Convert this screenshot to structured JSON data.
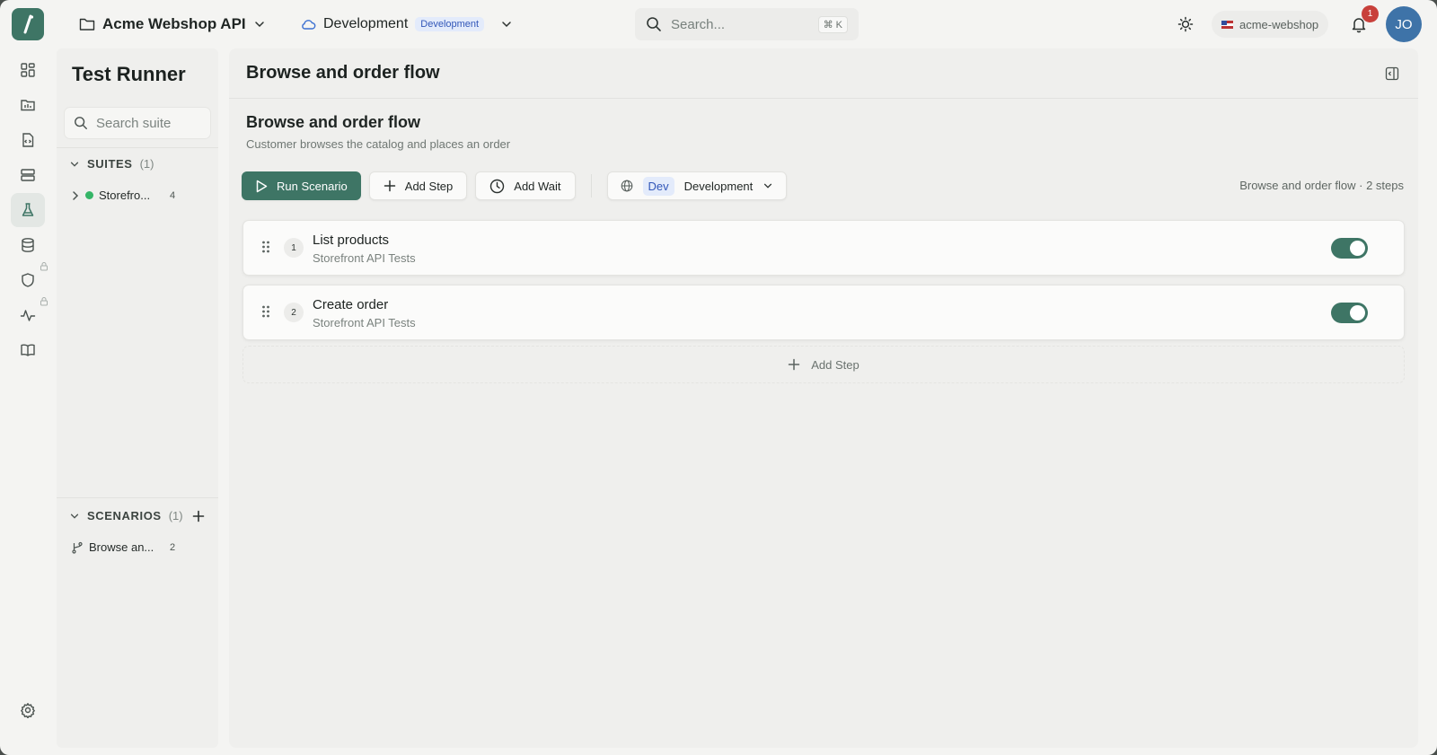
{
  "topbar": {
    "project_name": "Acme Webshop API",
    "environment_name": "Development",
    "environment_badge": "Development",
    "search_placeholder": "Search...",
    "search_shortcut": "⌘ K",
    "workspace": "acme-webshop",
    "notification_count": "1",
    "avatar_initials": "JO"
  },
  "sidebar": {
    "title": "Test Runner",
    "search_placeholder": "Search suite",
    "suites_label": "SUITES",
    "suites_count": "(1)",
    "suites": [
      {
        "name": "Storefro...",
        "count": "4",
        "status_color": "#35b567"
      }
    ],
    "scenarios_label": "SCENARIOS",
    "scenarios_count": "(1)",
    "scenarios": [
      {
        "name": "Browse an...",
        "count": "2"
      }
    ]
  },
  "main": {
    "header_title": "Browse and order flow",
    "scenario_title": "Browse and order flow",
    "scenario_description": "Customer browses the catalog and places an order",
    "toolbar": {
      "run_label": "Run Scenario",
      "add_step_label": "Add Step",
      "add_wait_label": "Add Wait",
      "env_chip": "Dev",
      "env_label": "Development"
    },
    "summary": "Browse and order flow · 2 steps",
    "steps": [
      {
        "number": "1",
        "name": "List products",
        "suite": "Storefront API Tests",
        "enabled": true
      },
      {
        "number": "2",
        "name": "Create order",
        "suite": "Storefront API Tests",
        "enabled": true
      }
    ],
    "add_step_row_label": "Add Step"
  },
  "colors": {
    "accent": "#3e7565",
    "badge_blue": "#3257b8",
    "notification": "#c8403b",
    "avatar": "#3e73a8"
  },
  "icons": {
    "rail": [
      "dashboard-icon",
      "collections-icon",
      "code-file-icon",
      "server-icon",
      "flask-icon",
      "database-icon",
      "shield-icon",
      "activity-icon",
      "book-icon",
      "settings-icon"
    ]
  }
}
